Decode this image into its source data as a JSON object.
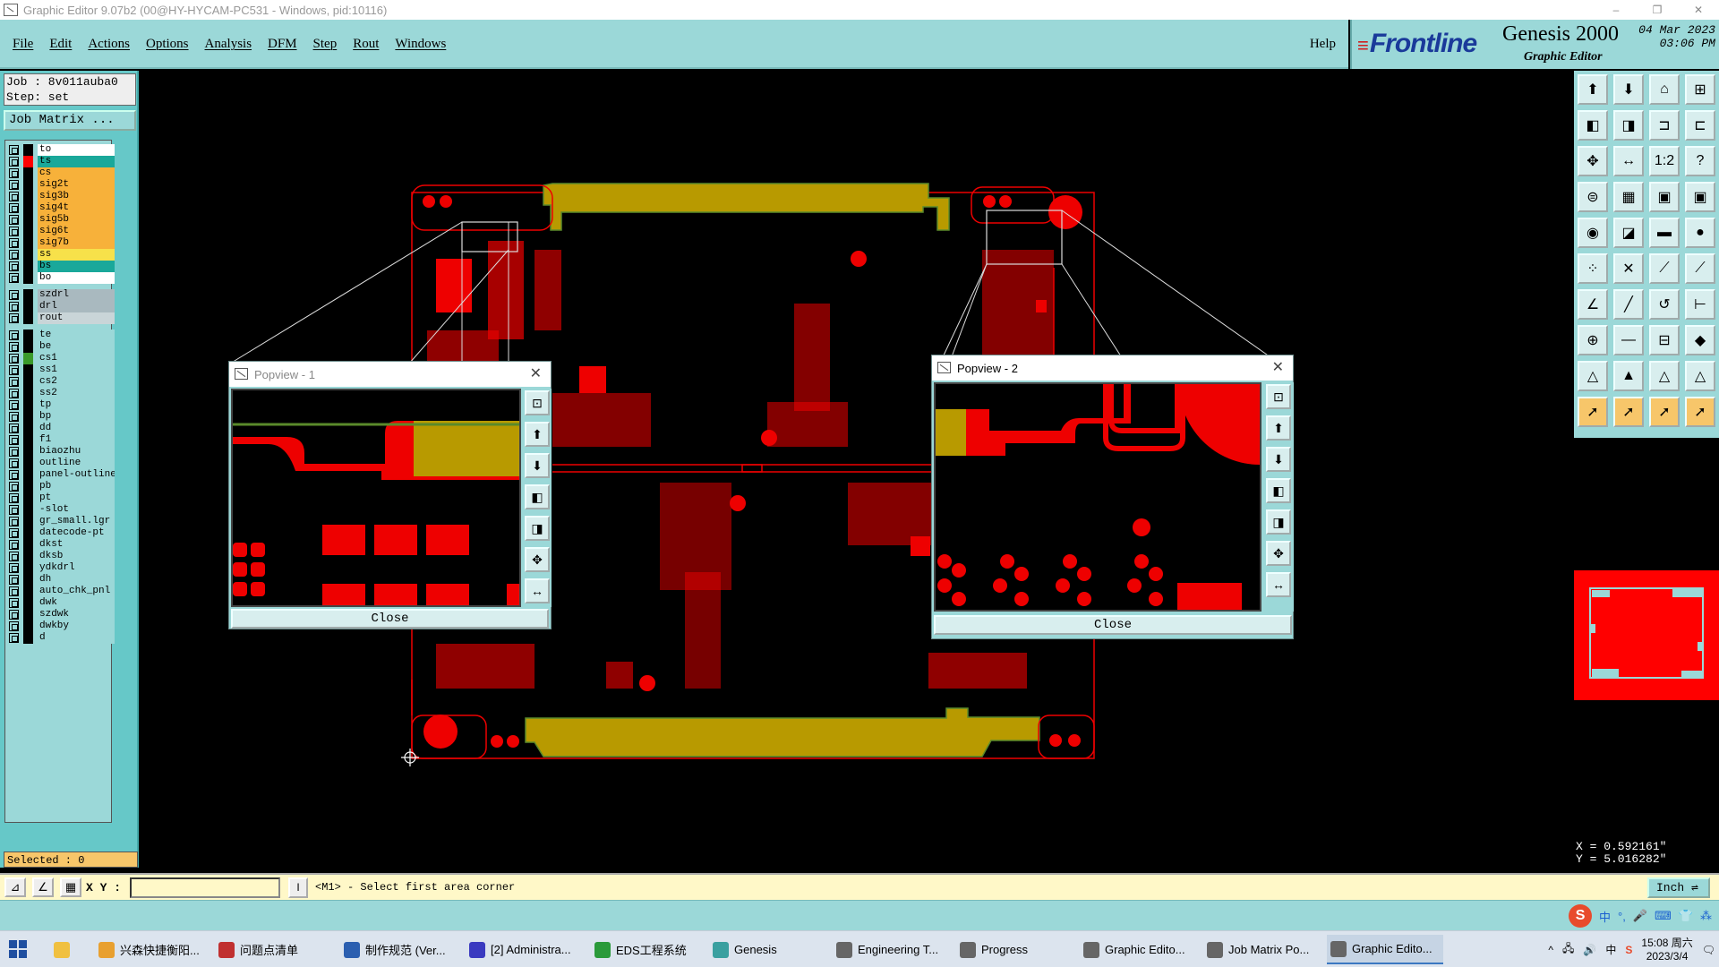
{
  "window": {
    "title": "Graphic Editor 9.07b2 (00@HY-HYCAM-PC531 - Windows, pid:10116)",
    "minimize": "–",
    "restore": "❐",
    "close": "✕"
  },
  "menubar": {
    "items": [
      "File",
      "Edit",
      "Actions",
      "Options",
      "Analysis",
      "DFM",
      "Step",
      "Rout",
      "Windows"
    ],
    "help": "Help"
  },
  "brand": {
    "logo": "Frontline",
    "logo_bars": "≡",
    "product": "Genesis 2000",
    "subtitle": "Graphic Editor",
    "date_line1": "04 Mar 2023",
    "date_line2": "03:06 PM"
  },
  "job": {
    "job_line": "Job : 8v011auba0",
    "step_line": "Step: set",
    "job_matrix_button": "Job Matrix ...",
    "selected": "Selected : 0"
  },
  "layers": [
    {
      "name": "to",
      "color": "#ffffff",
      "swatch": "#000000",
      "group": 0
    },
    {
      "name": "ts",
      "color": "#1aa89a",
      "swatch": "#ff0000",
      "group": 0,
      "active": true,
      "marker": "■"
    },
    {
      "name": "cs",
      "color": "#f7b13a",
      "swatch": "#000000",
      "group": 0
    },
    {
      "name": "sig2t",
      "color": "#f7b13a",
      "swatch": "#000000",
      "group": 0
    },
    {
      "name": "sig3b",
      "color": "#f7b13a",
      "swatch": "#000000",
      "group": 0
    },
    {
      "name": "sig4t",
      "color": "#f7b13a",
      "swatch": "#000000",
      "group": 0
    },
    {
      "name": "sig5b",
      "color": "#f7b13a",
      "swatch": "#000000",
      "group": 0
    },
    {
      "name": "sig6t",
      "color": "#f7b13a",
      "swatch": "#000000",
      "group": 0
    },
    {
      "name": "sig7b",
      "color": "#f7b13a",
      "swatch": "#000000",
      "group": 0
    },
    {
      "name": "ss",
      "color": "#f7e14a",
      "swatch": "#000000",
      "group": 0
    },
    {
      "name": "bs",
      "color": "#1aa89a",
      "swatch": "#000000",
      "group": 0
    },
    {
      "name": "bo",
      "color": "#ffffff",
      "swatch": "#000000",
      "group": 0
    },
    {
      "name": "szdrl",
      "color": "#a9b9bf",
      "swatch": "#000000",
      "group": 1
    },
    {
      "name": "drl",
      "color": "#a9b9bf",
      "swatch": "#000000",
      "group": 1
    },
    {
      "name": "rout",
      "color": "#c9d5d8",
      "swatch": "#000000",
      "group": 1
    },
    {
      "name": "te",
      "color": "#9bd8d8",
      "swatch": "#000000",
      "group": 2
    },
    {
      "name": "be",
      "color": "#9bd8d8",
      "swatch": "#000000",
      "group": 2
    },
    {
      "name": "cs1",
      "color": "#9bd8d8",
      "swatch": "#3a9a2a",
      "group": 2
    },
    {
      "name": "ss1",
      "color": "#9bd8d8",
      "swatch": "#000000",
      "group": 2
    },
    {
      "name": "cs2",
      "color": "#9bd8d8",
      "swatch": "#000000",
      "group": 2
    },
    {
      "name": "ss2",
      "color": "#9bd8d8",
      "swatch": "#000000",
      "group": 2
    },
    {
      "name": "tp",
      "color": "#9bd8d8",
      "swatch": "#000000",
      "group": 2
    },
    {
      "name": "bp",
      "color": "#9bd8d8",
      "swatch": "#000000",
      "group": 2
    },
    {
      "name": "dd",
      "color": "#9bd8d8",
      "swatch": "#000000",
      "group": 2
    },
    {
      "name": "f1",
      "color": "#9bd8d8",
      "swatch": "#000000",
      "group": 2
    },
    {
      "name": "biaozhu",
      "color": "#9bd8d8",
      "swatch": "#000000",
      "group": 2
    },
    {
      "name": "outline",
      "color": "#9bd8d8",
      "swatch": "#000000",
      "group": 2
    },
    {
      "name": "panel-outline",
      "color": "#9bd8d8",
      "swatch": "#000000",
      "group": 2
    },
    {
      "name": "pb",
      "color": "#9bd8d8",
      "swatch": "#000000",
      "group": 2
    },
    {
      "name": "pt",
      "color": "#9bd8d8",
      "swatch": "#000000",
      "group": 2
    },
    {
      "name": "-slot",
      "color": "#9bd8d8",
      "swatch": "#000000",
      "group": 2
    },
    {
      "name": "gr_small.lgr",
      "color": "#9bd8d8",
      "swatch": "#000000",
      "group": 2
    },
    {
      "name": "datecode-pt",
      "color": "#9bd8d8",
      "swatch": "#000000",
      "group": 2
    },
    {
      "name": "dkst",
      "color": "#9bd8d8",
      "swatch": "#000000",
      "group": 2
    },
    {
      "name": "dksb",
      "color": "#9bd8d8",
      "swatch": "#000000",
      "group": 2
    },
    {
      "name": "ydkdrl",
      "color": "#9bd8d8",
      "swatch": "#000000",
      "group": 2
    },
    {
      "name": "dh",
      "color": "#9bd8d8",
      "swatch": "#000000",
      "group": 2
    },
    {
      "name": "auto_chk_pnl",
      "color": "#9bd8d8",
      "swatch": "#000000",
      "group": 2
    },
    {
      "name": "dwk",
      "color": "#9bd8d8",
      "swatch": "#000000",
      "group": 2
    },
    {
      "name": "szdwk",
      "color": "#9bd8d8",
      "swatch": "#000000",
      "group": 2
    },
    {
      "name": "dwkby",
      "color": "#9bd8d8",
      "swatch": "#000000",
      "group": 2
    },
    {
      "name": "d",
      "color": "#9bd8d8",
      "swatch": "#000000",
      "group": 2
    }
  ],
  "popview1": {
    "title": "Popview - 1",
    "close_label": "Close",
    "close_x": "✕"
  },
  "popview2": {
    "title": "Popview - 2",
    "close_label": "Close",
    "close_x": "✕"
  },
  "coords": {
    "x": "X = 0.592161\"",
    "y": "Y = 5.016282\""
  },
  "command": {
    "xy_label": "X Y :",
    "xy_value": "",
    "i_button": "I",
    "prompt": "<M1> - Select first area corner",
    "unit": "Inch ⇌"
  },
  "tools": [
    "⬆",
    "⬇",
    "⌂",
    "⊞",
    "◧",
    "◨",
    "⊐",
    "⊏",
    "✥",
    "↔",
    "1:2",
    "?",
    "⊜",
    "▦",
    "▣",
    "▣",
    "◉",
    "◪",
    "▬",
    "●",
    "⁘",
    "✕",
    "⟋",
    "⟋",
    "∠",
    "╱",
    "↺",
    "⊢",
    "⊕",
    "—",
    "⊟",
    "◆",
    "△",
    "▲",
    "△",
    "△",
    "➚",
    "➚",
    "➚",
    "➚"
  ],
  "taskbar": {
    "items": [
      {
        "label": "兴森快捷衡阳...",
        "icon_color": "#e8a030"
      },
      {
        "label": "问题点清单",
        "icon_color": "#c03030"
      },
      {
        "label": "制作规范 (Ver...",
        "icon_color": "#2b5fb0"
      },
      {
        "label": "[2] Administra...",
        "icon_color": "#3a3ac0"
      },
      {
        "label": "EDS工程系统",
        "icon_color": "#2a9a3a"
      },
      {
        "label": "Genesis",
        "icon_color": "#3aa0a0"
      },
      {
        "label": "Engineering T...",
        "icon_color": "#666666"
      },
      {
        "label": "Progress",
        "icon_color": "#666666"
      },
      {
        "label": "Graphic Edito...",
        "icon_color": "#666666"
      },
      {
        "label": "Job Matrix Po...",
        "icon_color": "#666666"
      },
      {
        "label": "Graphic Edito...",
        "icon_color": "#666666",
        "active": true
      }
    ],
    "tray_items": [
      "^",
      "中",
      "S"
    ],
    "time": "15:08 周六",
    "date": "2023/3/4"
  },
  "ime": {
    "items": [
      "中",
      "°,",
      "🎤",
      "⌨",
      "👕",
      "⁂"
    ]
  }
}
